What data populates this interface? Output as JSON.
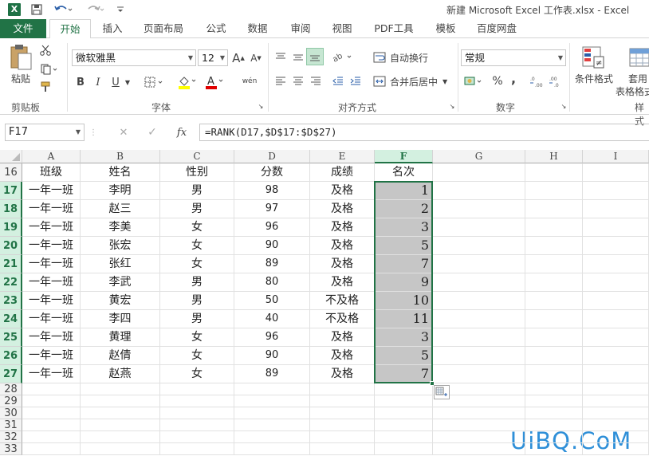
{
  "app": {
    "title": "新建 Microsoft Excel 工作表.xlsx - Excel",
    "logo": "X"
  },
  "quick_access": {
    "save_icon": "save-icon",
    "undo_icon": "undo-icon",
    "redo_icon": "redo-icon",
    "customize_icon": "customize-icon"
  },
  "tabs": [
    {
      "label": "文件"
    },
    {
      "label": "开始"
    },
    {
      "label": "插入"
    },
    {
      "label": "页面布局"
    },
    {
      "label": "公式"
    },
    {
      "label": "数据"
    },
    {
      "label": "审阅"
    },
    {
      "label": "视图"
    },
    {
      "label": "PDF工具"
    },
    {
      "label": "模板"
    },
    {
      "label": "百度网盘"
    }
  ],
  "ribbon": {
    "clipboard": {
      "paste_label": "粘贴",
      "group_label": "剪贴板"
    },
    "font": {
      "font_name": "微软雅黑",
      "font_size": "12",
      "bold": "B",
      "italic": "I",
      "underline": "U",
      "grow": "A",
      "shrink": "A",
      "pinyin": "wén",
      "group_label": "字体"
    },
    "alignment": {
      "wrap_text": "自动换行",
      "merge_center": "合并后居中",
      "group_label": "对齐方式"
    },
    "number": {
      "format": "常规",
      "percent": "%",
      "comma": ",",
      "group_label": "数字"
    },
    "styles": {
      "conditional_format": "条件格式",
      "table_format_1": "套用",
      "table_format_2": "表格格式",
      "group_label": "样式"
    }
  },
  "formula_bar": {
    "name_box": "F17",
    "cancel": "✕",
    "enter": "✓",
    "fx": "fx",
    "formula": "=RANK(D17,$D$17:$D$27)"
  },
  "columns": [
    "A",
    "B",
    "C",
    "D",
    "E",
    "F",
    "G",
    "H",
    "I"
  ],
  "selected_column": "F",
  "header_row": {
    "row": "16",
    "cells": [
      "班级",
      "姓名",
      "性别",
      "分数",
      "成绩",
      "名次"
    ]
  },
  "rows": [
    {
      "row": "17",
      "cells": [
        "一年一班",
        "李明",
        "男",
        "98",
        "及格",
        "1"
      ]
    },
    {
      "row": "18",
      "cells": [
        "一年一班",
        "赵三",
        "男",
        "97",
        "及格",
        "2"
      ]
    },
    {
      "row": "19",
      "cells": [
        "一年一班",
        "李美",
        "女",
        "96",
        "及格",
        "3"
      ]
    },
    {
      "row": "20",
      "cells": [
        "一年一班",
        "张宏",
        "女",
        "90",
        "及格",
        "5"
      ]
    },
    {
      "row": "21",
      "cells": [
        "一年一班",
        "张红",
        "女",
        "89",
        "及格",
        "7"
      ]
    },
    {
      "row": "22",
      "cells": [
        "一年一班",
        "李武",
        "男",
        "80",
        "及格",
        "9"
      ]
    },
    {
      "row": "23",
      "cells": [
        "一年一班",
        "黄宏",
        "男",
        "50",
        "不及格",
        "10"
      ]
    },
    {
      "row": "24",
      "cells": [
        "一年一班",
        "李四",
        "男",
        "40",
        "不及格",
        "11"
      ]
    },
    {
      "row": "25",
      "cells": [
        "一年一班",
        "黄理",
        "女",
        "96",
        "及格",
        "3"
      ]
    },
    {
      "row": "26",
      "cells": [
        "一年一班",
        "赵倩",
        "女",
        "90",
        "及格",
        "5"
      ]
    },
    {
      "row": "27",
      "cells": [
        "一年一班",
        "赵燕",
        "女",
        "89",
        "及格",
        "7"
      ]
    }
  ],
  "empty_rows": [
    "28",
    "29",
    "30",
    "31",
    "32",
    "33"
  ],
  "watermark": "UiBQ.CoM",
  "colors": {
    "accent": "#217346",
    "selection_fill": "#c6c6c6",
    "watermark": "#2e8fd8"
  }
}
